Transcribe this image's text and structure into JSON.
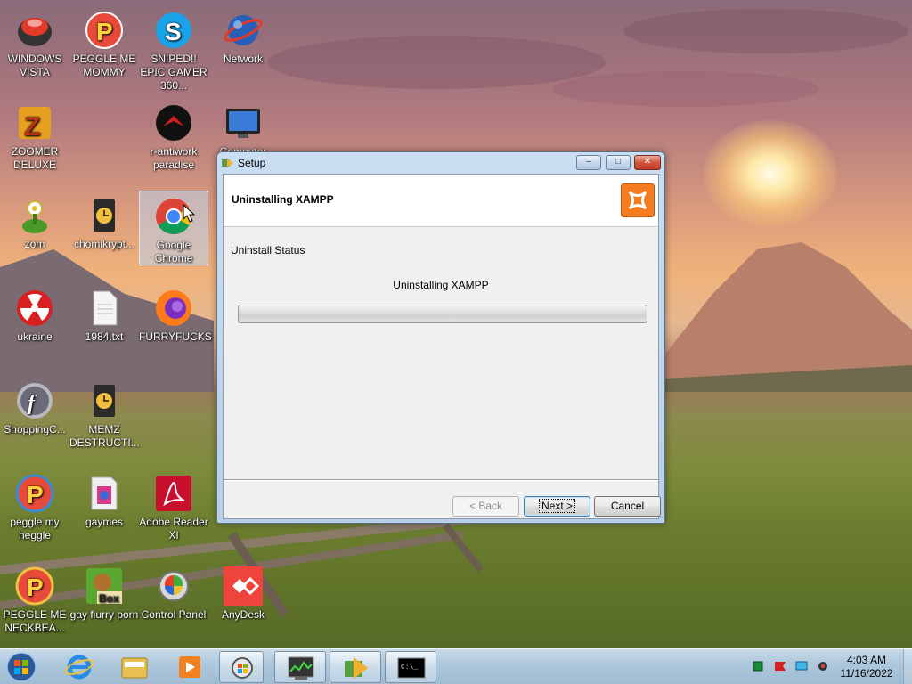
{
  "desktop": {
    "icons": [
      {
        "label": "WINDOWS VISTA",
        "icon": "windows-vista-ball-icon"
      },
      {
        "label": "PEGGLE ME MOMMY",
        "icon": "peggle-icon"
      },
      {
        "label": "SNIPED!! EPIC GAMER 360...",
        "icon": "skype-icon"
      },
      {
        "label": "Network",
        "icon": "network-globe-icon"
      },
      {
        "label": "ZOOMER DELUXE",
        "icon": "zuma-icon"
      },
      {
        "label": "r-antiwork paradise",
        "icon": "red-logo-icon"
      },
      {
        "label": "Computer",
        "icon": "computer-monitor-icon"
      },
      {
        "label": "zom",
        "icon": "plant-icon"
      },
      {
        "label": "chomikrypt...",
        "icon": "clock-file-icon"
      },
      {
        "label": "Google Chrome",
        "icon": "chrome-icon"
      },
      {
        "label": "ukraine",
        "icon": "radiation-icon"
      },
      {
        "label": "1984.txt",
        "icon": "text-file-icon"
      },
      {
        "label": "FURRYFUCKS",
        "icon": "firefox-icon"
      },
      {
        "label": "ShoppingC...",
        "icon": "flash-icon"
      },
      {
        "label": "MEMZ DESTRUCTI...",
        "icon": "clock-file-icon"
      },
      {
        "label": "peggle my heggle",
        "icon": "peggle-icon"
      },
      {
        "label": "gaymes",
        "icon": "games-folder-icon"
      },
      {
        "label": "Adobe Reader XI",
        "icon": "adobe-reader-icon"
      },
      {
        "label": "PEGGLE ME NECKBEA...",
        "icon": "peggle-icon"
      },
      {
        "label": "gay fiurry porn",
        "icon": "box-bear-icon"
      },
      {
        "label": "Control Panel",
        "icon": "control-panel-icon"
      },
      {
        "label": "AnyDesk",
        "icon": "anydesk-icon"
      }
    ]
  },
  "dialog": {
    "title": "Setup",
    "header_title": "Uninstalling XAMPP",
    "status_label": "Uninstall Status",
    "status_text": "Uninstalling XAMPP",
    "progress": 0,
    "buttons": {
      "back": "< Back",
      "next": "Next >",
      "cancel": "Cancel"
    },
    "window_controls": {
      "minimize": "–",
      "maximize": "□",
      "close": "✕"
    }
  },
  "taskbar": {
    "pinned": [
      "internet-explorer-icon",
      "explorer-folder-icon",
      "media-player-icon",
      "vista-orb-app-icon",
      "task-manager-icon",
      "setup-arrow-icon",
      "cmd-icon"
    ],
    "tray": [
      "green-tray-icon",
      "flag-icon",
      "monitor-tray-icon",
      "speaker-icon"
    ],
    "clock": {
      "time": "4:03 AM",
      "date": "11/16/2022"
    }
  },
  "colors": {
    "accent": "#f47c20",
    "taskbar": "#aec8dc",
    "dialog_frame": "#b7d0e8"
  }
}
